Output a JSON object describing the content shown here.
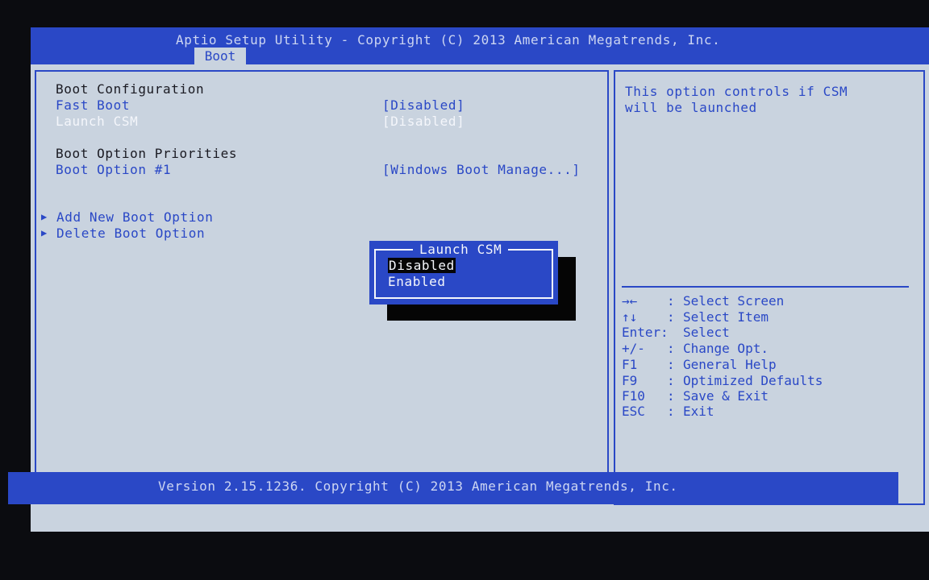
{
  "header": {
    "title": "Aptio Setup Utility - Copyright (C) 2013 American Megatrends, Inc.",
    "active_tab": "Boot"
  },
  "main": {
    "section_boot_config": "Boot Configuration",
    "fast_boot_label": "Fast Boot",
    "fast_boot_value": "[Disabled]",
    "launch_csm_label": "Launch CSM",
    "launch_csm_value": "[Disabled]",
    "section_priorities": "Boot Option Priorities",
    "boot_option1_label": "Boot Option #1",
    "boot_option1_value": "[Windows Boot Manage...]",
    "add_boot_option": "Add New Boot Option",
    "delete_boot_option": "Delete Boot Option",
    "submenu_arrow_icon": "triangle-right-icon"
  },
  "popup": {
    "title": "Launch CSM",
    "options": [
      "Disabled",
      "Enabled"
    ],
    "selected": "Disabled"
  },
  "help": {
    "description_line1": "This option controls if CSM",
    "description_line2": "will be launched",
    "keys": [
      {
        "key": "→←",
        "sep": ":",
        "desc": "Select Screen"
      },
      {
        "key": "↑↓",
        "sep": ":",
        "desc": "Select Item"
      },
      {
        "key": "Enter",
        "sep": ":",
        "desc": "Select"
      },
      {
        "key": "+/-",
        "sep": ":",
        "desc": "Change Opt."
      },
      {
        "key": "F1",
        "sep": ":",
        "desc": "General Help"
      },
      {
        "key": "F9",
        "sep": ":",
        "desc": "Optimized Defaults"
      },
      {
        "key": "F10",
        "sep": ":",
        "desc": "Save & Exit"
      },
      {
        "key": "ESC",
        "sep": ":",
        "desc": "Exit"
      }
    ]
  },
  "footer": {
    "text": "Version 2.15.1236. Copyright (C) 2013 American Megatrends, Inc."
  },
  "colors": {
    "bios_blue": "#2a48c6",
    "panel_gray": "#c9d3df",
    "text_dark": "#1a1a22",
    "highlight_white": "#f4f6fb"
  }
}
